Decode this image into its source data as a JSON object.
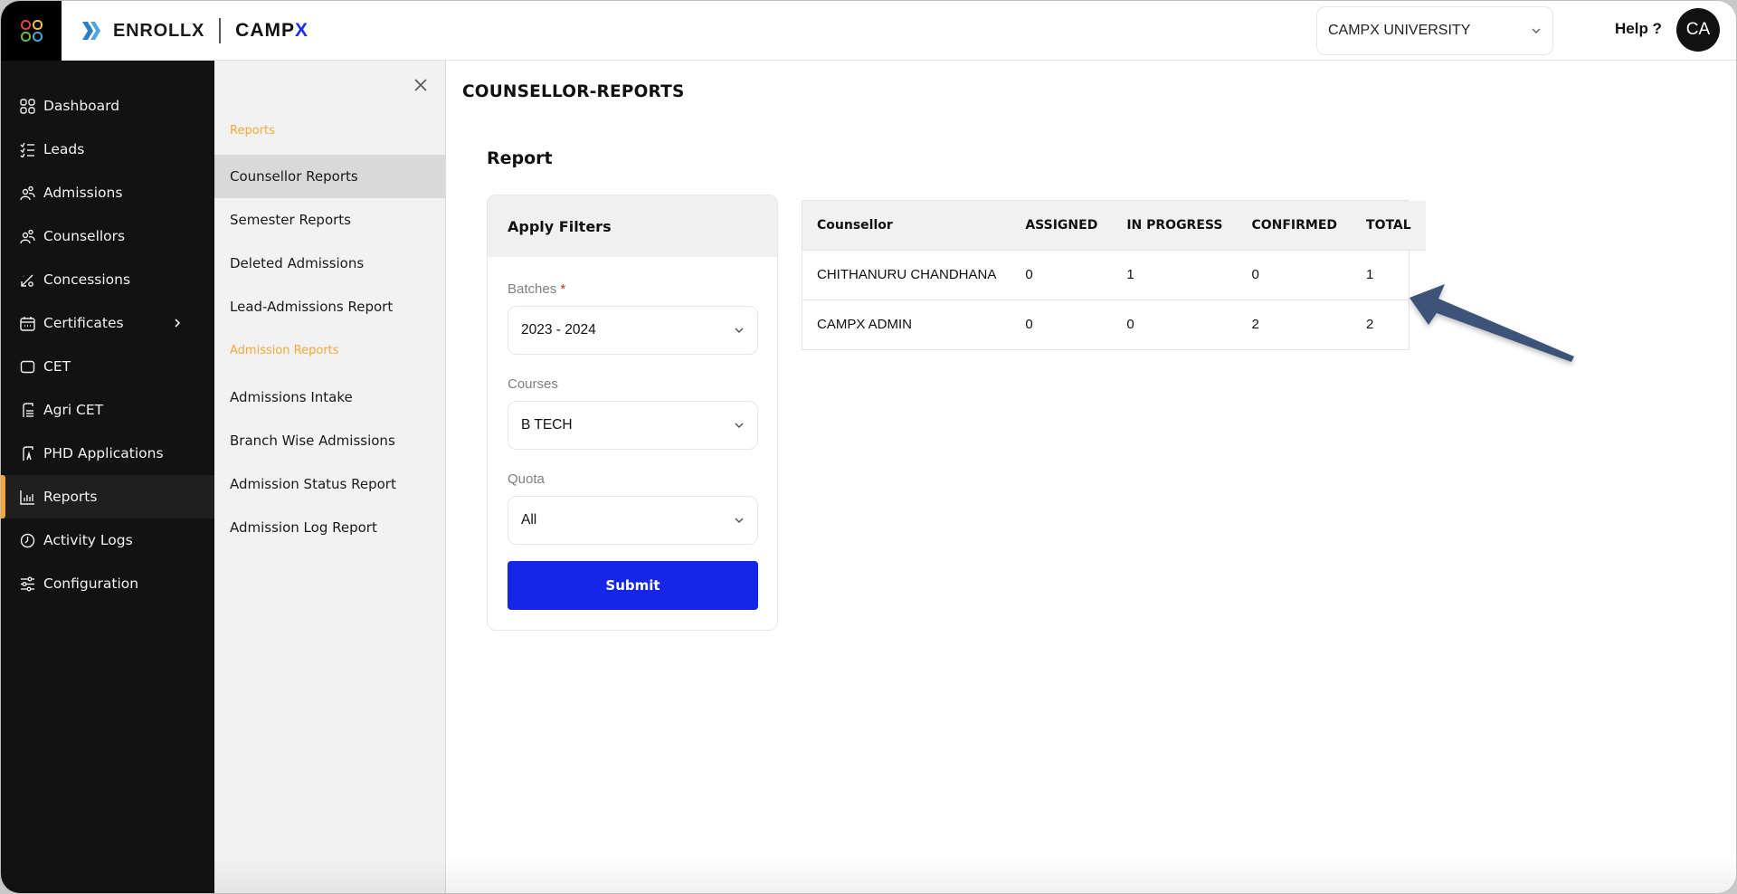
{
  "topbar": {
    "brand_left": "ENROLLX",
    "brand_right_main": "CAMP",
    "brand_right_accent": "X",
    "university_select": "CAMPX UNIVERSITY",
    "help_label": "Help ?",
    "avatar_initials": "CA"
  },
  "sidebar": {
    "items": [
      {
        "label": "Dashboard",
        "icon": "dashboard-icon"
      },
      {
        "label": "Leads",
        "icon": "checklist-icon"
      },
      {
        "label": "Admissions",
        "icon": "users-icon"
      },
      {
        "label": "Counsellors",
        "icon": "users-icon"
      },
      {
        "label": "Concessions",
        "icon": "percent-icon"
      },
      {
        "label": "Certificates",
        "icon": "calendar-icon",
        "has_children": true
      },
      {
        "label": "CET",
        "icon": "square-icon"
      },
      {
        "label": "Agri CET",
        "icon": "document-icon"
      },
      {
        "label": "PHD Applications",
        "icon": "application-icon"
      },
      {
        "label": "Reports",
        "icon": "bar-chart-icon",
        "active": true
      },
      {
        "label": "Activity Logs",
        "icon": "clock-icon"
      },
      {
        "label": "Configuration",
        "icon": "sliders-icon"
      }
    ]
  },
  "subpanel": {
    "sections": [
      {
        "title": "Reports",
        "items": [
          "Counsellor Reports",
          "Semester Reports",
          "Deleted Admissions",
          "Lead-Admissions Report"
        ]
      },
      {
        "title": "Admission Reports",
        "items": [
          "Admissions Intake",
          "Branch Wise Admissions",
          "Admission Status Report",
          "Admission Log Report"
        ]
      }
    ],
    "active_item": "Counsellor Reports"
  },
  "main": {
    "page_title": "COUNSELLOR-REPORTS",
    "report_title": "Report",
    "filters": {
      "title": "Apply Filters",
      "batches_label": "Batches",
      "batches_required": "*",
      "batches_value": "2023 - 2024",
      "courses_label": "Courses",
      "courses_value": "B TECH",
      "quota_label": "Quota",
      "quota_value": "All",
      "submit_label": "Submit"
    },
    "table": {
      "columns": [
        "Counsellor",
        "ASSIGNED",
        "IN PROGRESS",
        "CONFIRMED",
        "TOTAL"
      ],
      "rows": [
        [
          "CHITHANURU CHANDHANA",
          "0",
          "1",
          "0",
          "1"
        ],
        [
          "CAMPX ADMIN",
          "0",
          "0",
          "2",
          "2"
        ]
      ]
    }
  },
  "colors": {
    "accent_orange": "#f2a93b",
    "primary_blue": "#1626e8",
    "sidebar_bg": "#121212",
    "annotation_arrow": "#3d5378"
  }
}
